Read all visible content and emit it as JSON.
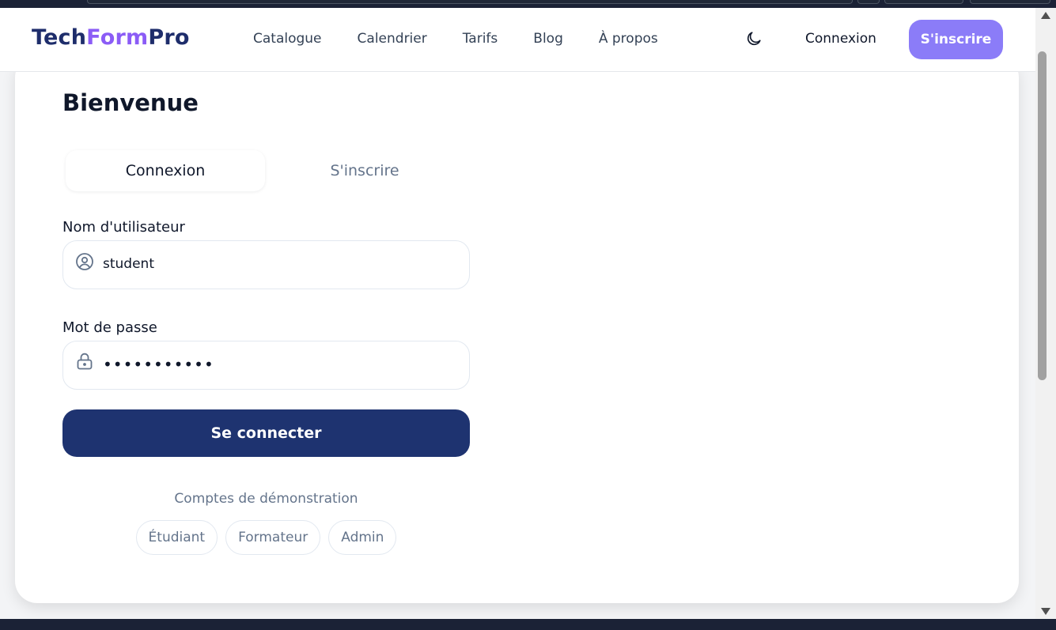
{
  "header": {
    "logo": {
      "part1": "Tech",
      "part2": "Form",
      "part3": "Pro"
    },
    "nav": [
      "Catalogue",
      "Calendrier",
      "Tarifs",
      "Blog",
      "À propos"
    ],
    "theme_icon": "moon-icon",
    "login_label": "Connexion",
    "signup_label": "S'inscrire"
  },
  "card": {
    "title": "Bienvenue",
    "tabs": {
      "login": "Connexion",
      "signup": "S'inscrire",
      "active": "login"
    },
    "username": {
      "label": "Nom d'utilisateur",
      "value": "student",
      "icon": "user-circle-icon"
    },
    "password": {
      "label": "Mot de passe",
      "value": "•••••••••••",
      "icon": "lock-icon"
    },
    "submit_label": "Se connecter",
    "demo": {
      "title": "Comptes de démonstration",
      "accounts": [
        "Étudiant",
        "Formateur",
        "Admin"
      ]
    }
  },
  "colors": {
    "brand_dark": "#1e2d6b",
    "brand_accent": "#8b5cf6",
    "signup_button": "#8b7cf8",
    "submit_button": "#1e3370"
  }
}
